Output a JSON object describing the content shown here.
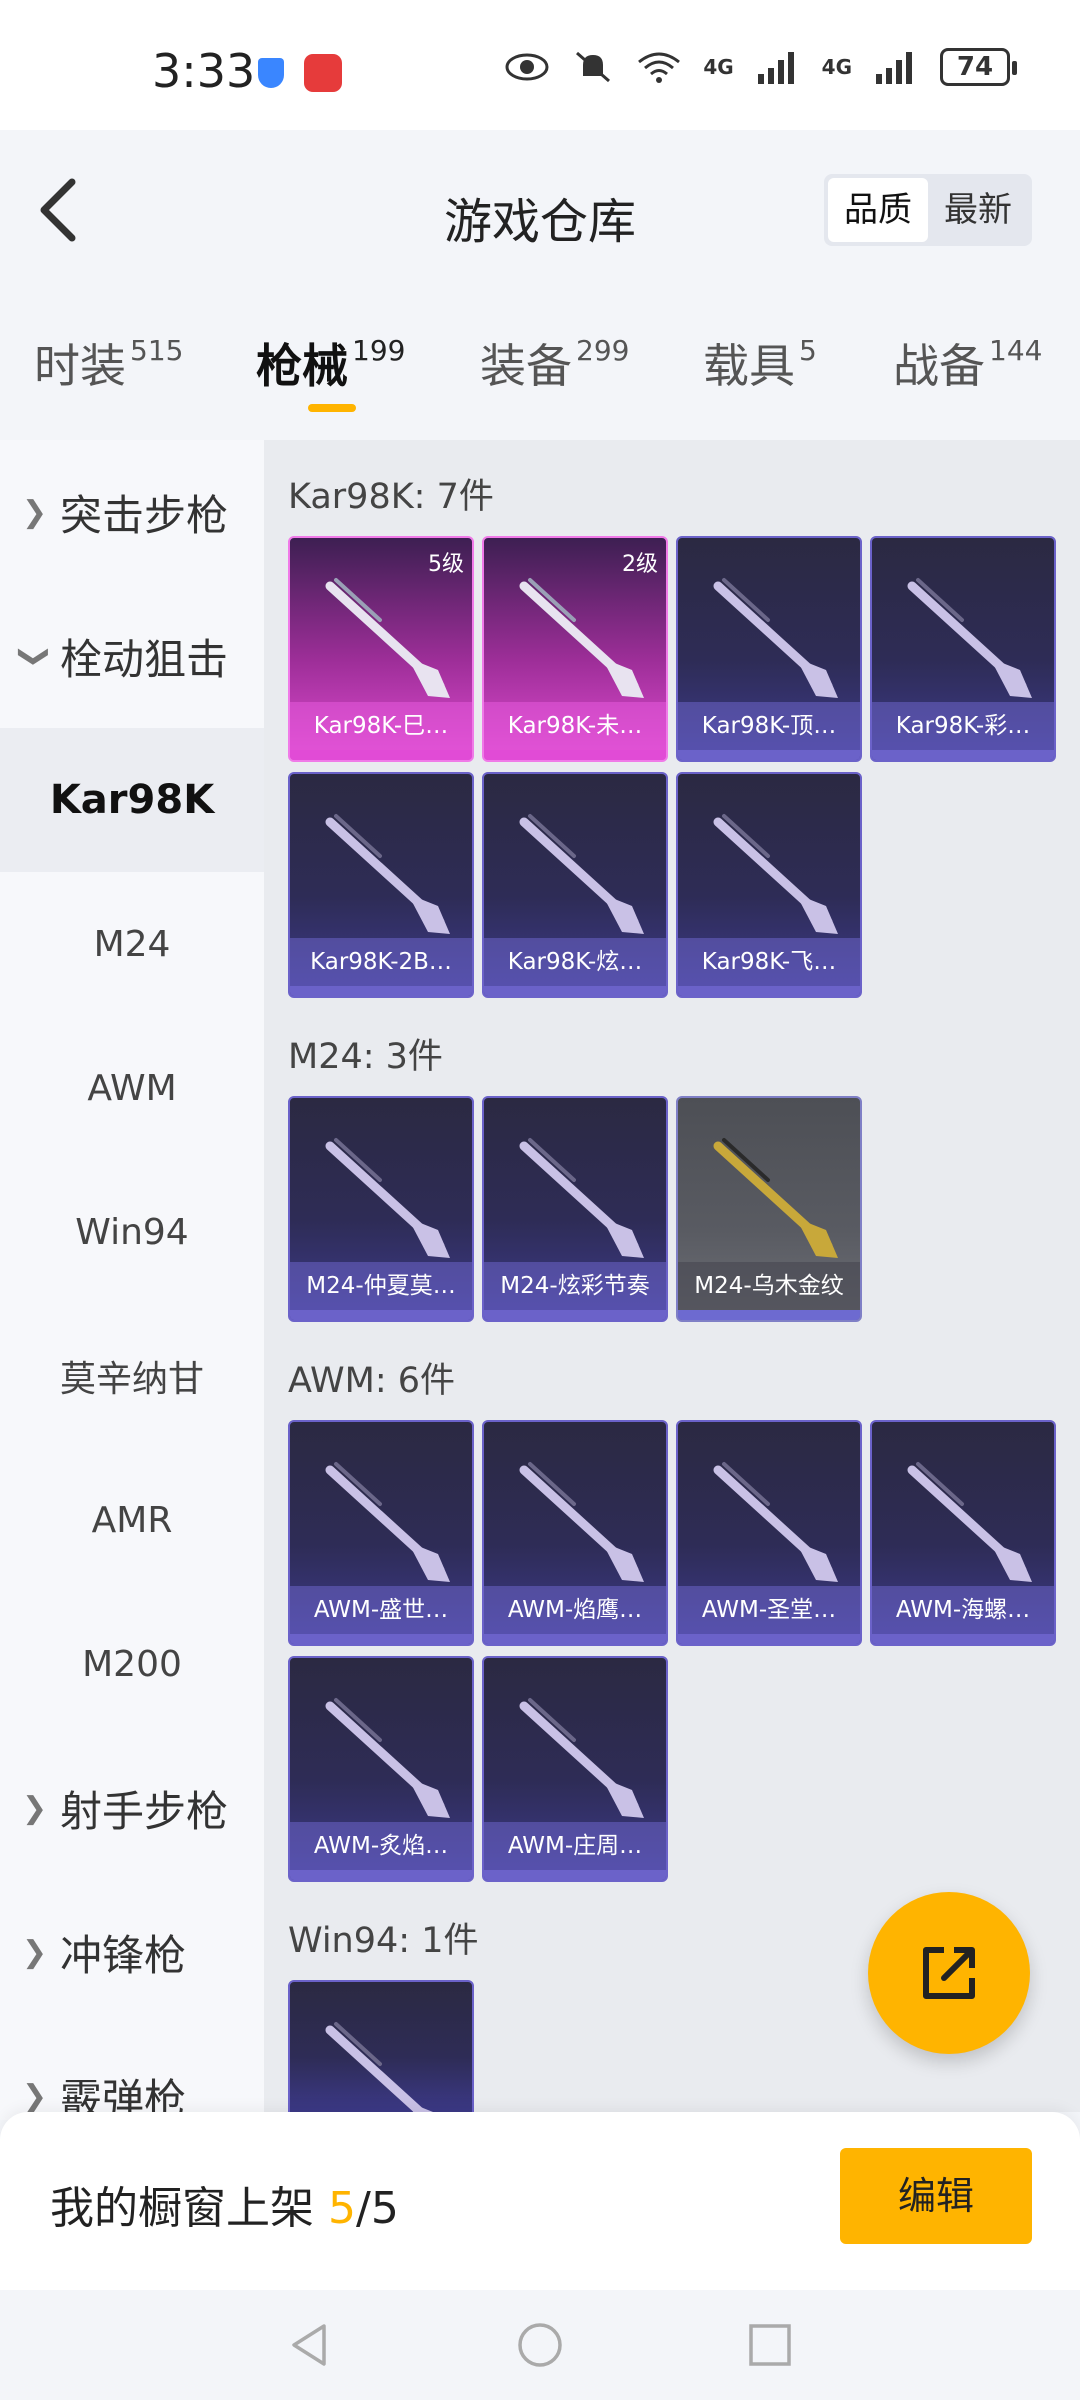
{
  "status_bar": {
    "time": "3:33",
    "battery": "74",
    "network_1": "4G",
    "network_2": "4G"
  },
  "header": {
    "title": "游戏仓库",
    "sort_options": [
      "品质",
      "最新"
    ],
    "active_sort": "品质"
  },
  "tabs": [
    {
      "label": "时装",
      "count": "515"
    },
    {
      "label": "枪械",
      "count": "199"
    },
    {
      "label": "装备",
      "count": "299"
    },
    {
      "label": "载具",
      "count": "5"
    },
    {
      "label": "战备",
      "count": "144"
    }
  ],
  "active_tab": "枪械",
  "sidebar": {
    "items": [
      {
        "label": "突击步枪",
        "type": "group",
        "chevron": "right"
      },
      {
        "label": "栓动狙击",
        "type": "group",
        "chevron": "down"
      },
      {
        "label": "Kar98K",
        "type": "sub",
        "selected": true
      },
      {
        "label": "M24",
        "type": "sub"
      },
      {
        "label": "AWM",
        "type": "sub"
      },
      {
        "label": "Win94",
        "type": "sub"
      },
      {
        "label": "莫辛纳甘",
        "type": "sub"
      },
      {
        "label": "AMR",
        "type": "sub"
      },
      {
        "label": "M200",
        "type": "sub"
      },
      {
        "label": "射手步枪",
        "type": "group",
        "chevron": "right"
      },
      {
        "label": "冲锋枪",
        "type": "group",
        "chevron": "right"
      },
      {
        "label": "霰弹枪",
        "type": "group",
        "chevron": "right"
      }
    ]
  },
  "sections": [
    {
      "title": "Kar98K: 7件",
      "items": [
        {
          "name": "Kar98K-巳…",
          "tier": "5级",
          "style": "pink"
        },
        {
          "name": "Kar98K-未…",
          "tier": "2级",
          "style": "pink"
        },
        {
          "name": "Kar98K-顶…",
          "tier": "",
          "style": "purple"
        },
        {
          "name": "Kar98K-彩…",
          "tier": "",
          "style": "purple"
        },
        {
          "name": "Kar98K-2B…",
          "tier": "",
          "style": "purple"
        },
        {
          "name": "Kar98K-炫…",
          "tier": "",
          "style": "purple"
        },
        {
          "name": "Kar98K-飞…",
          "tier": "",
          "style": "purple"
        }
      ]
    },
    {
      "title": "M24: 3件",
      "items": [
        {
          "name": "M24-仲夏莫…",
          "tier": "",
          "style": "purple"
        },
        {
          "name": "M24-炫彩节奏",
          "tier": "",
          "style": "purple"
        },
        {
          "name": "M24-乌木金纹",
          "tier": "",
          "style": "gray"
        }
      ]
    },
    {
      "title": "AWM: 6件",
      "items": [
        {
          "name": "AWM-盛世…",
          "tier": "",
          "style": "purple"
        },
        {
          "name": "AWM-焰鹰…",
          "tier": "",
          "style": "purple"
        },
        {
          "name": "AWM-圣堂…",
          "tier": "",
          "style": "purple"
        },
        {
          "name": "AWM-海螺…",
          "tier": "",
          "style": "purple"
        },
        {
          "name": "AWM-炙焰…",
          "tier": "",
          "style": "purple"
        },
        {
          "name": "AWM-庄周…",
          "tier": "",
          "style": "purple"
        }
      ]
    },
    {
      "title": "Win94: 1件",
      "items": [
        {
          "name": "",
          "tier": "",
          "style": "purple"
        }
      ]
    }
  ],
  "bottom_bar": {
    "shelf_label": "我的橱窗上架",
    "shelf_current": "5",
    "shelf_total": "/5",
    "edit_label": "编辑"
  },
  "colors": {
    "accent": "#ffb400",
    "card_purple": "#3d3a8c",
    "card_pink": "#e04bd1",
    "card_gray": "#595b62"
  },
  "icons": {
    "back": "back-icon",
    "fab": "share-edit-icon",
    "nav": [
      "nav-back-icon",
      "nav-home-icon",
      "nav-recents-icon"
    ]
  }
}
